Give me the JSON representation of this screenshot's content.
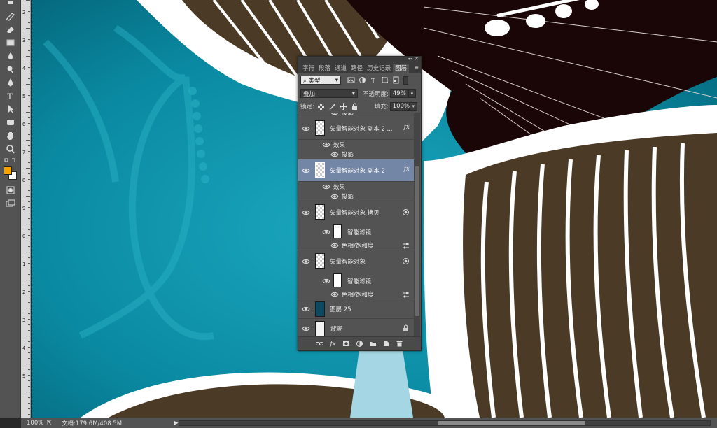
{
  "panel": {
    "tabs": [
      {
        "label": "字符"
      },
      {
        "label": "段落"
      },
      {
        "label": "通道"
      },
      {
        "label": "路径"
      },
      {
        "label": "历史记录"
      },
      {
        "label": "图层"
      }
    ],
    "filter_kind": "类型",
    "blend_mode": "叠加",
    "opacity_label": "不透明度:",
    "opacity_value": "49%",
    "lock_label": "锁定:",
    "fill_label": "填充:",
    "fill_value": "100%",
    "layers": [
      {
        "name": "投影",
        "kind": "sub-effect"
      },
      {
        "name": "矢量智能对象 副本 2 ...",
        "kind": "layer",
        "fx": "fx"
      },
      {
        "name": "效果",
        "kind": "effects"
      },
      {
        "name": "投影",
        "kind": "sub-effect"
      },
      {
        "name": "矢量智能对象 副本 2",
        "kind": "layer",
        "fx": "fx",
        "selected": true
      },
      {
        "name": "效果",
        "kind": "effects"
      },
      {
        "name": "投影",
        "kind": "sub-effect"
      },
      {
        "name": "矢量智能对象 拷贝",
        "kind": "layer"
      },
      {
        "name": "智能滤镜",
        "kind": "smart-filter"
      },
      {
        "name": "色相/饱和度",
        "kind": "filter-item"
      },
      {
        "name": "矢量智能对象",
        "kind": "layer"
      },
      {
        "name": "智能滤镜",
        "kind": "smart-filter"
      },
      {
        "name": "色相/饱和度",
        "kind": "filter-item"
      },
      {
        "name": "图层 25",
        "kind": "layer"
      },
      {
        "name": "背景",
        "kind": "background"
      }
    ]
  },
  "status": {
    "zoom": "100%",
    "doc_info": "文档:179.6M/408.5M"
  },
  "ruler_numbers": [
    "2",
    "3",
    "4",
    "5",
    "6",
    "7",
    "8",
    "9",
    "0",
    "1",
    "2",
    "3",
    "4",
    "5"
  ],
  "colors": {
    "foreground": "#f4a300",
    "background": "#ffffff",
    "panel_bg": "#535353",
    "selected_layer": "#7386a6",
    "teal": "#0a8fa6",
    "dark_brown": "#1a0606",
    "brown": "#4a3a26"
  }
}
